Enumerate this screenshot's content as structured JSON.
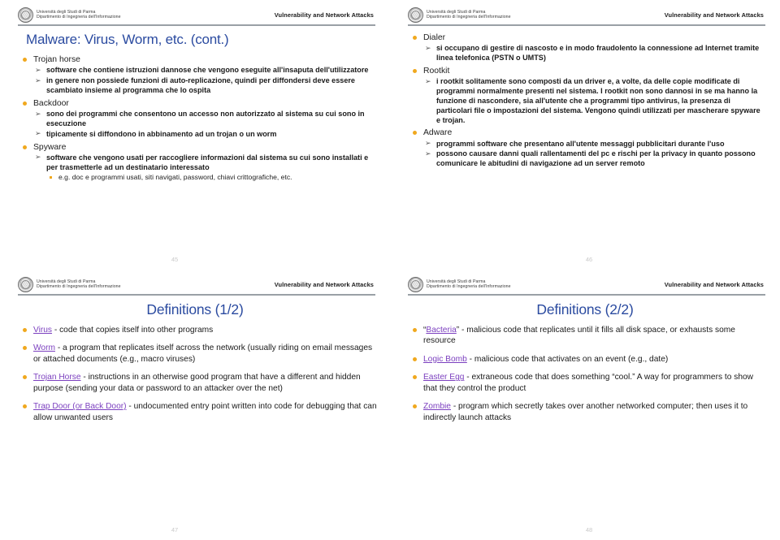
{
  "document": {
    "type": "lecture-slides-handout",
    "course": "Vulnerability and Network Attacks",
    "institution_line1": "Università degli Studi di Parma",
    "institution_line2": "Dipartimento di Ingegneria dell'Informazione",
    "colors": {
      "title_blue": "#2b4ba0",
      "bullet_orange": "#f0a81e",
      "term_purple": "#7b3fbf",
      "rule_gray": "#9aa0a6",
      "page_number_gray": "#c9c9c9"
    }
  },
  "slides": [
    {
      "number": "45",
      "title": "Malware: Virus, Worm, etc. (cont.)",
      "title_align": "left",
      "items": [
        {
          "label": "Trojan horse",
          "sub": [
            "software che contiene istruzioni dannose che vengono eseguite all'insaputa dell'utilizzatore",
            "in genere non possiede funzioni di auto-replicazione, quindi per diffondersi deve essere scambiato insieme al programma che lo ospita"
          ]
        },
        {
          "label": "Backdoor",
          "sub": [
            "sono dei programmi che consentono un accesso non autorizzato al sistema su cui sono in esecuzione",
            "tipicamente si diffondono in abbinamento ad un trojan o un worm"
          ]
        },
        {
          "label": "Spyware",
          "sub": [
            "software che vengono usati per raccogliere informazioni dal sistema su cui sono installati e per trasmetterle ad un destinatario interessato"
          ],
          "sub_sub": [
            "e.g. doc e programmi usati, siti navigati, password, chiavi crittografiche, etc."
          ]
        }
      ]
    },
    {
      "number": "46",
      "title": "",
      "title_align": "left",
      "items": [
        {
          "label": "Dialer",
          "sub": [
            "si occupano di gestire di nascosto e in modo fraudolento la connessione ad Internet tramite linea telefonica (PSTN o UMTS)"
          ]
        },
        {
          "label": "Rootkit",
          "sub": [
            "i rootkit solitamente sono composti da un driver e, a volte, da delle copie modificate di programmi normalmente presenti nel sistema. I rootkit non sono dannosi in se ma hanno la funzione di nascondere, sia all'utente che a programmi tipo antivirus, la presenza di particolari file o impostazioni del sistema. Vengono quindi utilizzati per mascherare spyware e trojan."
          ]
        },
        {
          "label": "Adware",
          "sub": [
            "programmi software che presentano all'utente messaggi pubblicitari durante l'uso",
            "possono causare danni quali rallentamenti del pc e rischi per la privacy in quanto possono comunicare le abitudini di navigazione ad un server remoto"
          ]
        }
      ]
    },
    {
      "number": "47",
      "title": "Definitions (1/2)",
      "title_align": "center",
      "definitions": [
        {
          "term": "Virus",
          "quoted": false,
          "text": " - code that copies itself into other programs"
        },
        {
          "term": "Worm",
          "quoted": false,
          "text": " - a program that replicates itself across the network (usually riding on email messages or attached documents (e.g., macro viruses)"
        },
        {
          "term": "Trojan Horse",
          "quoted": false,
          "text": " - instructions in an otherwise good program that have a different and hidden purpose (sending your data or password to an attacker over the net)"
        },
        {
          "term": "Trap Door (or Back Door)",
          "quoted": false,
          "text": " - undocumented entry point written into code for debugging that can allow unwanted users"
        }
      ]
    },
    {
      "number": "48",
      "title": "Definitions (2/2)",
      "title_align": "center",
      "definitions": [
        {
          "term": "Bacteria",
          "quoted": true,
          "text": " - malicious code that replicates until it fills all disk space, or exhausts some resource"
        },
        {
          "term": "Logic Bomb",
          "quoted": false,
          "text": " - malicious code that activates on an event (e.g., date)"
        },
        {
          "term": "Easter Egg",
          "quoted": false,
          "text": " - extraneous code that does something “cool.”  A way for programmers to show that they control the product"
        },
        {
          "term": "Zombie",
          "quoted": false,
          "text": " - program which secretly takes over another networked computer; then uses it to indirectly launch attacks"
        }
      ]
    }
  ],
  "icons": {
    "arrow_bullet": "➢",
    "crest": "university-crest"
  }
}
